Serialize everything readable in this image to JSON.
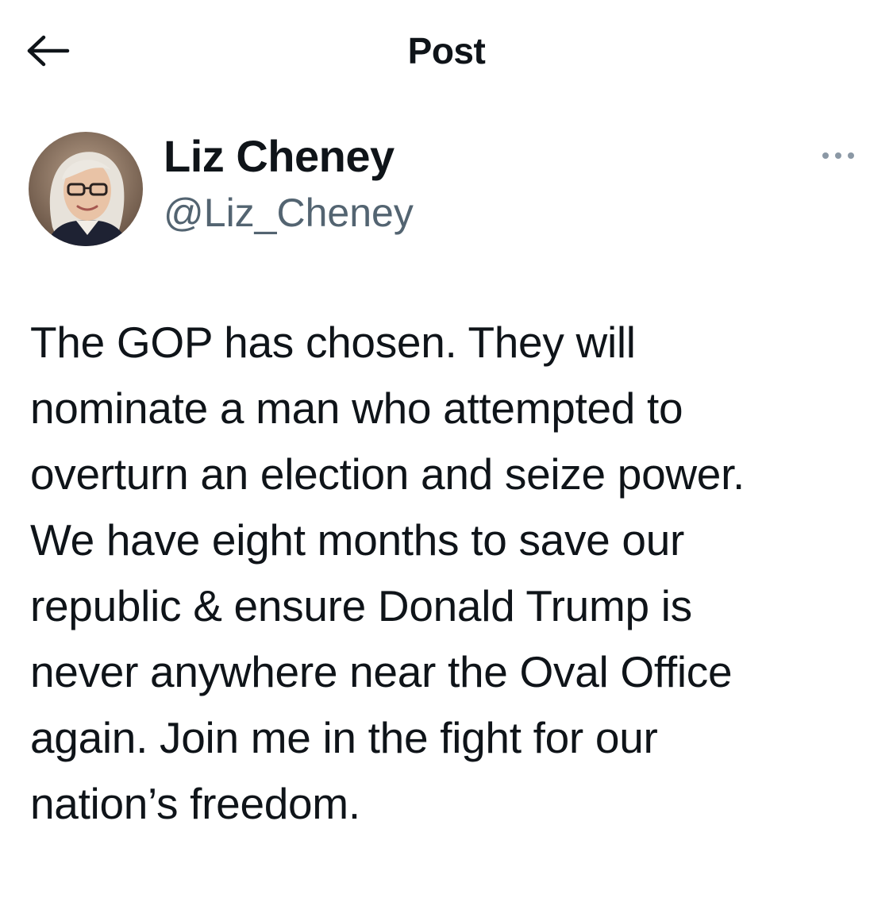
{
  "header": {
    "title": "Post",
    "back_icon": "arrow-left-icon"
  },
  "author": {
    "display_name": "Liz Cheney",
    "handle": "@Liz_Cheney",
    "avatar_icon": "profile-photo",
    "more_icon": "more-horizontal-icon"
  },
  "post": {
    "lines": [
      "The GOP has chosen. They will",
      "nominate a man who attempted to",
      "overturn an election and seize power.",
      "We have eight months to save our",
      "republic & ensure Donald Trump is",
      "never anywhere near the Oval Office",
      "again. Join me in the fight for our",
      "nation’s freedom."
    ]
  },
  "colors": {
    "text": "#0f1419",
    "secondary": "#536471",
    "background": "#ffffff"
  }
}
